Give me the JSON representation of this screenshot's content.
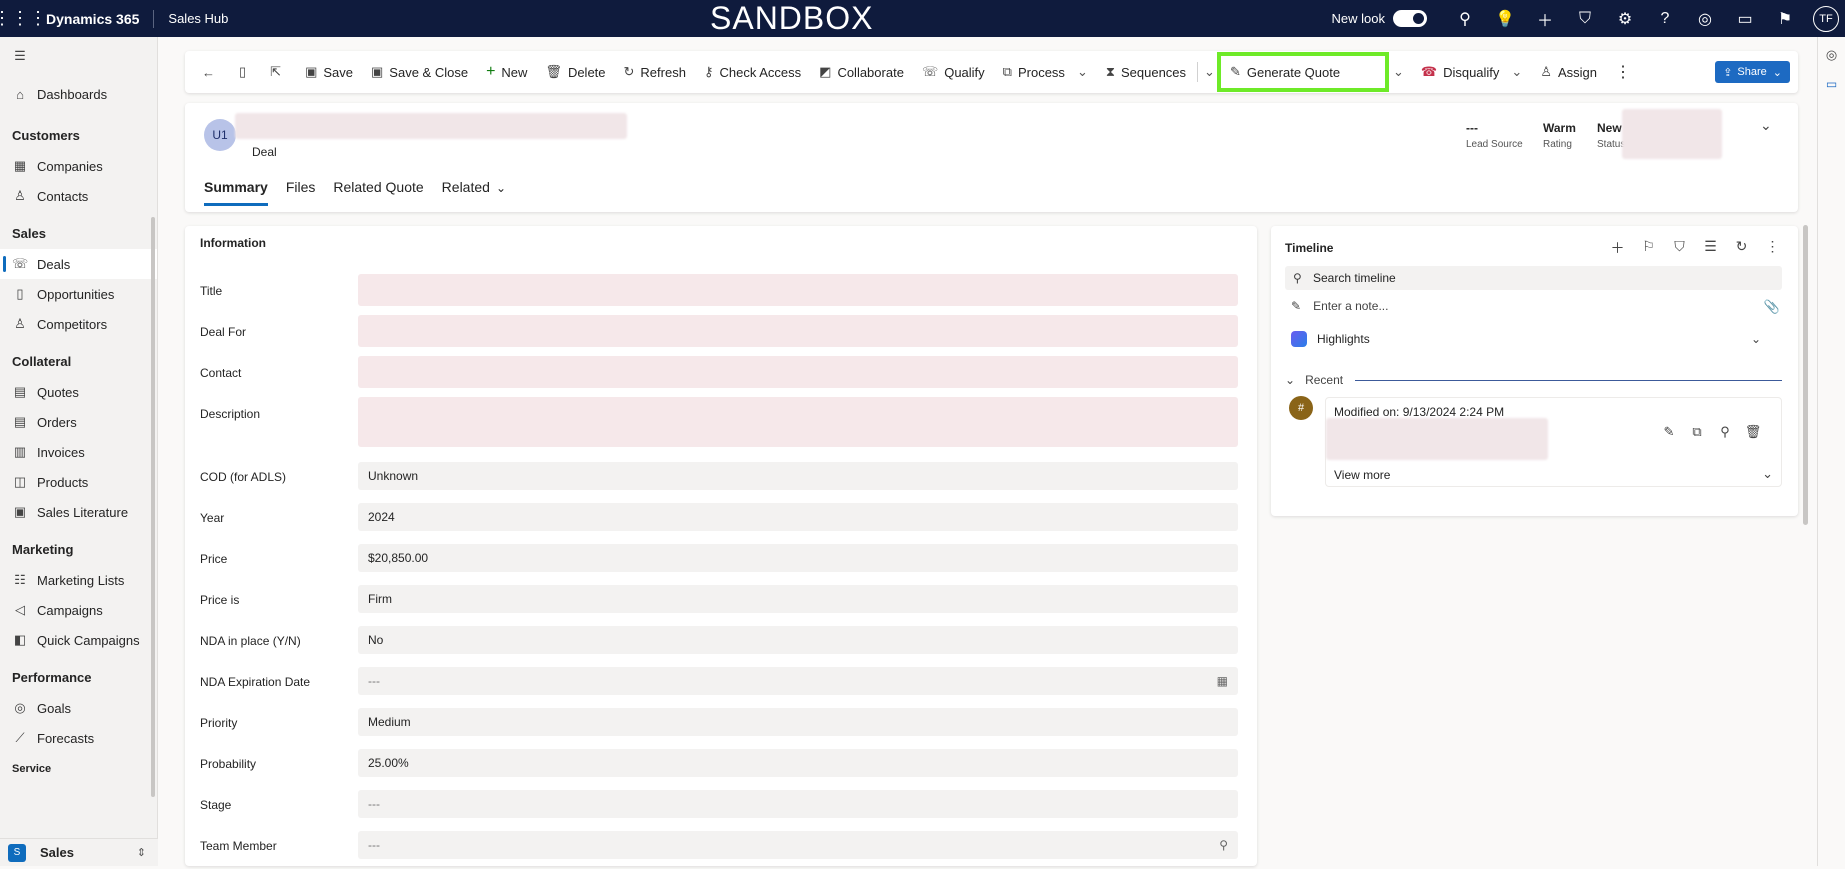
{
  "topbar": {
    "brand": "Dynamics 365",
    "app": "Sales Hub",
    "environment": "SANDBOX",
    "new_look": "New look",
    "user_initials": "TF"
  },
  "sidebar": {
    "dashboards": "Dashboards",
    "groups": [
      {
        "title": "Customers",
        "items": [
          {
            "label": "Companies",
            "icon": "building-icon"
          },
          {
            "label": "Contacts",
            "icon": "person-icon"
          }
        ]
      },
      {
        "title": "Sales",
        "items": [
          {
            "label": "Deals",
            "icon": "deal-icon"
          },
          {
            "label": "Opportunities",
            "icon": "opportunity-icon"
          },
          {
            "label": "Competitors",
            "icon": "person-icon"
          }
        ]
      },
      {
        "title": "Collateral",
        "items": [
          {
            "label": "Quotes",
            "icon": "document-icon"
          },
          {
            "label": "Orders",
            "icon": "document-icon"
          },
          {
            "label": "Invoices",
            "icon": "invoice-icon"
          },
          {
            "label": "Products",
            "icon": "box-icon"
          },
          {
            "label": "Sales Literature",
            "icon": "literature-icon"
          }
        ]
      },
      {
        "title": "Marketing",
        "items": [
          {
            "label": "Marketing Lists",
            "icon": "list-icon"
          },
          {
            "label": "Campaigns",
            "icon": "megaphone-icon"
          },
          {
            "label": "Quick Campaigns",
            "icon": "quick-campaign-icon"
          }
        ]
      },
      {
        "title": "Performance",
        "items": [
          {
            "label": "Goals",
            "icon": "target-icon"
          },
          {
            "label": "Forecasts",
            "icon": "chart-icon"
          }
        ]
      }
    ],
    "service_partial": "Service",
    "area_badge": "S",
    "area": "Sales"
  },
  "commands": {
    "save": "Save",
    "save_close": "Save & Close",
    "new": "New",
    "delete": "Delete",
    "refresh": "Refresh",
    "check_access": "Check Access",
    "collaborate": "Collaborate",
    "qualify": "Qualify",
    "process": "Process",
    "sequences": "Sequences",
    "generate_quote": "Generate Quote",
    "disqualify": "Disqualify",
    "assign": "Assign",
    "share": "Share"
  },
  "header": {
    "avatar": "U1",
    "entity": "Deal",
    "lead_source_value": "---",
    "lead_source_label": "Lead Source",
    "rating_value": "Warm",
    "rating_label": "Rating",
    "status_value": "New",
    "status_label": "Status",
    "tabs": [
      "Summary",
      "Files",
      "Related Quote",
      "Related"
    ]
  },
  "info": {
    "title": "Information",
    "fields": [
      {
        "label": "Title",
        "value": ""
      },
      {
        "label": "Deal For",
        "value": ""
      },
      {
        "label": "Contact",
        "value": ""
      },
      {
        "label": "Description",
        "value": ""
      },
      {
        "label": "COD (for ADLS)",
        "value": "Unknown"
      },
      {
        "label": "Year",
        "value": "2024"
      },
      {
        "label": "Price",
        "value": "$20,850.00"
      },
      {
        "label": "Price is",
        "value": "Firm"
      },
      {
        "label": "NDA in place (Y/N)",
        "value": "No"
      },
      {
        "label": "NDA Expiration Date",
        "value": "---"
      },
      {
        "label": "Priority",
        "value": "Medium"
      },
      {
        "label": "Probability",
        "value": "25.00%"
      },
      {
        "label": "Stage",
        "value": "---"
      },
      {
        "label": "Team Member",
        "value": "---"
      }
    ]
  },
  "timeline": {
    "title": "Timeline",
    "search_placeholder": "Search timeline",
    "note_placeholder": "Enter a note...",
    "highlights": "Highlights",
    "recent": "Recent",
    "entry_avatar": "#",
    "entry_modified": "Modified on: 9/13/2024 2:24 PM",
    "view_more": "View more"
  },
  "colors": {
    "topbar": "#0f1b3d",
    "accent": "#0f6cbd",
    "highlight_outline": "#6eea28"
  }
}
